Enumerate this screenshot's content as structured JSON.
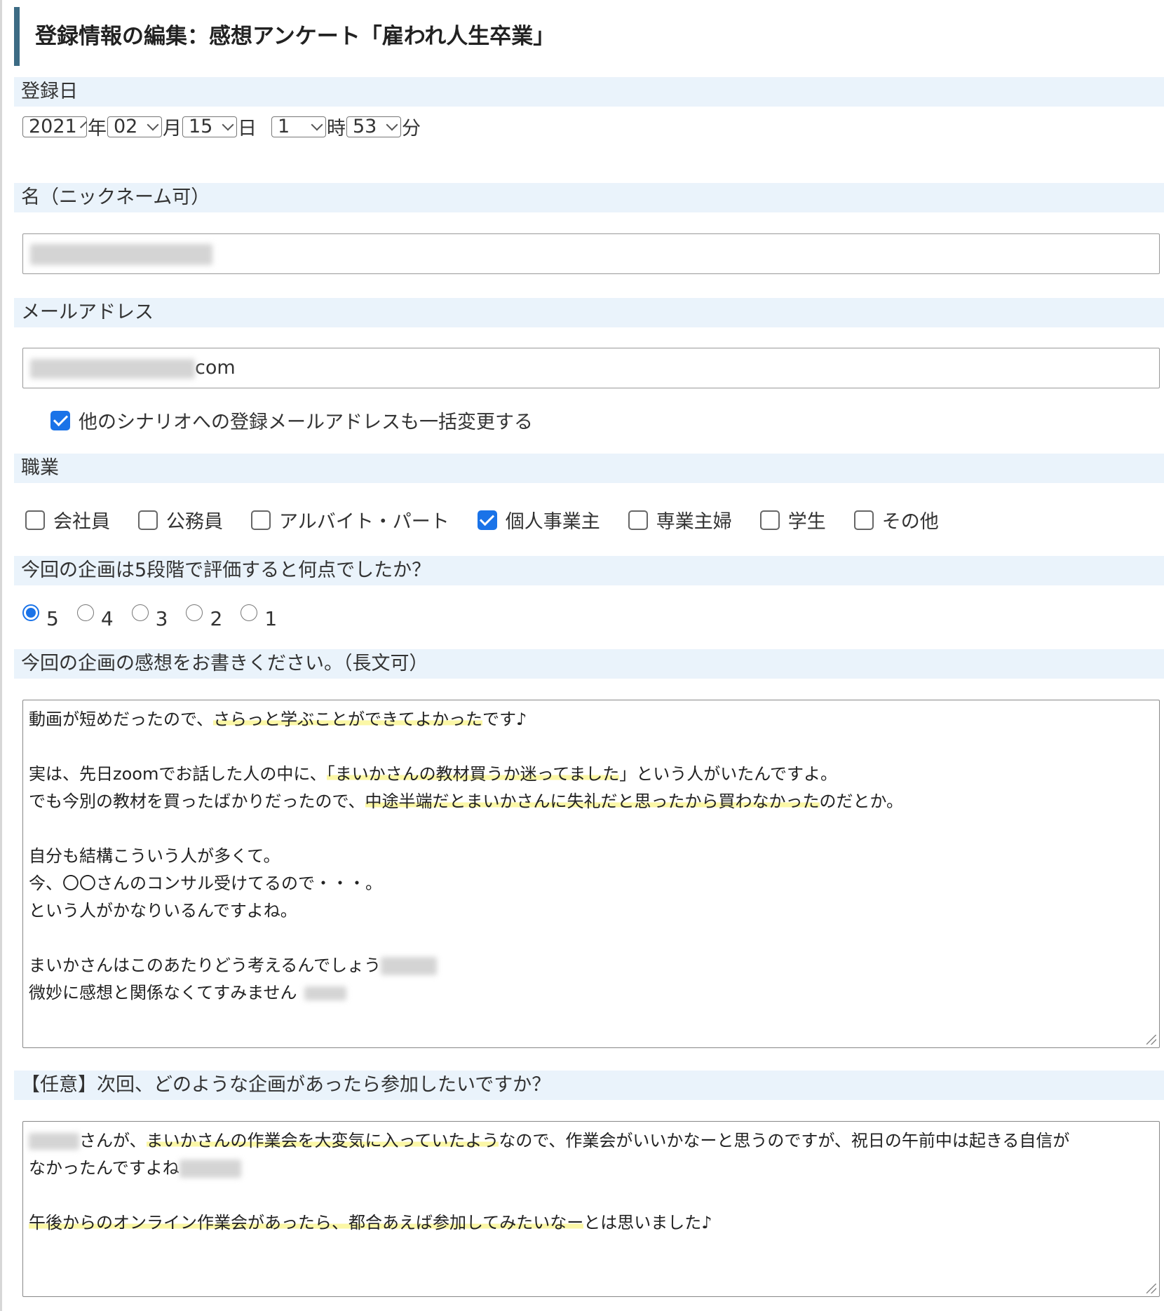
{
  "page": {
    "title": "登録情報の編集：感想アンケート「雇われ人生卒業」"
  },
  "reg_date": {
    "label": "登録日",
    "year": "2021",
    "year_unit": "年",
    "month": "02",
    "month_unit": "月",
    "day": "15",
    "day_unit": "日",
    "hour": "1",
    "hour_unit": "時",
    "minute": "53",
    "minute_unit": "分"
  },
  "name": {
    "label": "名（ニックネーム可）",
    "value_visible_prefix": ""
  },
  "email": {
    "label": "メールアドレス",
    "value_visible_suffix": "com",
    "bulk_change_label": "他のシナリオへの登録メールアドレスも一括変更する",
    "bulk_change_checked": true
  },
  "occupation": {
    "label": "職業",
    "options": [
      {
        "label": "会社員",
        "checked": false
      },
      {
        "label": "公務員",
        "checked": false
      },
      {
        "label": "アルバイト・パート",
        "checked": false
      },
      {
        "label": "個人事業主",
        "checked": true
      },
      {
        "label": "専業主婦",
        "checked": false
      },
      {
        "label": "学生",
        "checked": false
      },
      {
        "label": "その他",
        "checked": false
      }
    ]
  },
  "rating": {
    "label": "今回の企画は5段階で評価すると何点でしたか？",
    "options": [
      "5",
      "4",
      "3",
      "2",
      "1"
    ],
    "selected": "5"
  },
  "impression": {
    "label": "今回の企画の感想をお書きください。（長文可）",
    "lines": {
      "l1_a": "動画が短めだったので、",
      "l1_b": "さらっと学ぶことができてよかった",
      "l1_c": "です♪",
      "l3_a": "実は、先日zoomでお話した人の中に、",
      "l3_b": "「まいかさんの教材買うか迷ってました",
      "l3_c": "」という人がいたんですよ。",
      "l4_a": "でも今別の教材を買ったばかりだったので、",
      "l4_b": "中途半端だとまいかさんに失礼だと思ったから買わなかった",
      "l4_c": "のだとか。",
      "l6": "自分も結構こういう人が多くて。",
      "l7": "今、〇〇さんのコンサル受けてるので・・・。",
      "l8": "という人がかなりいるんですよね。",
      "l10": "まいかさんはこのあたりどう考えるんでしょう",
      "l11": "微妙に感想と関係なくてすみません"
    }
  },
  "next_plan": {
    "label": "【任意】次回、どのような企画があったら参加したいですか？",
    "lines": {
      "l1_a": "さんが、",
      "l1_b": "まいかさんの作業会を大変気に入っていたよう",
      "l1_c": "なので、作業会がいいかなーと思うのですが、祝日の午前中は起きる自信が",
      "l2": "なかったんですよね",
      "l4_a": "午後からのオンライン作業会があったら、都合あえば参加してみたいなー",
      "l4_b": "とは思いました♪"
    }
  }
}
